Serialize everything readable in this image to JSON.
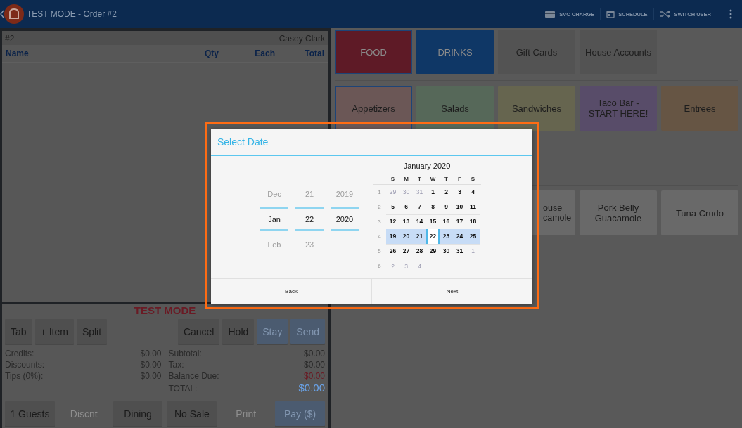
{
  "topbar": {
    "title": "TEST MODE - Order #2",
    "actions": [
      {
        "label": "SVC CHARGE",
        "kind": "card"
      },
      {
        "label": "SCHEDULE",
        "kind": "calendar"
      },
      {
        "label": "SWITCH USER",
        "kind": "shuffle"
      }
    ]
  },
  "order": {
    "number": "#2",
    "customer": "Casey Clark",
    "columns": [
      "Name",
      "Qty",
      "Each",
      "Total"
    ],
    "mode_banner": "TEST MODE",
    "actions": [
      {
        "label": "Tab",
        "kind": "plain",
        "disabled": false
      },
      {
        "label": "+ Item",
        "kind": "plain",
        "disabled": false
      },
      {
        "label": "Split",
        "kind": "plain",
        "disabled": false
      },
      {
        "label": "Cancel",
        "kind": "plain",
        "disabled": false
      },
      {
        "label": "Hold",
        "kind": "plain",
        "disabled": false
      },
      {
        "label": "Stay",
        "kind": "primary",
        "disabled": true
      },
      {
        "label": "Send",
        "kind": "primary",
        "disabled": true
      }
    ],
    "left_totals": [
      {
        "label": "Credits:",
        "value": "$0.00",
        "kind": "plain"
      },
      {
        "label": "Discounts:",
        "value": "$0.00",
        "kind": "plain"
      },
      {
        "label": "Tips (0%):",
        "value": "$0.00",
        "kind": "plain"
      }
    ],
    "right_totals": [
      {
        "label": "Subtotal:",
        "value": "$0.00",
        "kind": "plain"
      },
      {
        "label": "Tax:",
        "value": "$0.00",
        "kind": "plain"
      },
      {
        "label": "Balance Due:",
        "value": "$0.00",
        "kind": "due"
      },
      {
        "label": "TOTAL:",
        "value": "$0.00",
        "kind": "total"
      }
    ],
    "bottom_actions": [
      {
        "label": "1 Guests",
        "kind": "plain",
        "disabled": false
      },
      {
        "label": "Discnt",
        "kind": "plain",
        "disabled": true
      },
      {
        "label": "Dining",
        "kind": "plain",
        "disabled": false
      },
      {
        "label": "No Sale",
        "kind": "plain",
        "disabled": false
      },
      {
        "label": "Print",
        "kind": "plain",
        "disabled": true
      },
      {
        "label": "Pay ($)",
        "kind": "primary",
        "disabled": true
      }
    ]
  },
  "menu": {
    "rows": [
      {
        "tiles": [
          {
            "label": "FOOD",
            "color": "#5e1a26",
            "selected": true
          },
          {
            "label": "DRINKS",
            "color": "#0f3766",
            "selected": false
          },
          {
            "label": "Gift Cards",
            "color": "#535353",
            "selected": false
          },
          {
            "label": "House Accounts",
            "color": "#535353",
            "selected": false
          }
        ]
      },
      {
        "tiles": [
          {
            "label": "Appetizers",
            "color": "#6b5756",
            "selected": true
          },
          {
            "label": "Salads",
            "color": "#566859",
            "selected": false
          },
          {
            "label": "Sandwiches",
            "color": "#66654f",
            "selected": false
          },
          {
            "label": "Taco Bar - START HERE!",
            "color": "#584c69",
            "selected": false
          },
          {
            "label": "Entrees",
            "color": "#665544",
            "selected": false
          }
        ]
      },
      {
        "tiles": [
          {
            "label": "ouse camole",
            "color": "#696969",
            "selected": false,
            "kind": "partial"
          },
          {
            "label": "Pork Belly Guacamole",
            "color": "#696969",
            "selected": false,
            "kind": "full"
          },
          {
            "label": "Tuna Crudo",
            "color": "#696969",
            "selected": false,
            "kind": "full"
          }
        ]
      }
    ]
  },
  "dialog": {
    "title": "Select Date",
    "spinners": [
      {
        "prev": "Dec",
        "current": "Jan",
        "next": "Feb"
      },
      {
        "prev": "21",
        "current": "22",
        "next": "23"
      },
      {
        "prev": "2019",
        "current": "2020"
      }
    ],
    "calendar": {
      "month": "January 2020",
      "weekdays": [
        "S",
        "M",
        "T",
        "W",
        "T",
        "F",
        "S"
      ],
      "weeks": [
        {
          "number": "1",
          "days": [
            {
              "label": "29",
              "muted": true,
              "in_range": false,
              "selected": false
            },
            {
              "label": "30",
              "muted": true,
              "in_range": false,
              "selected": false
            },
            {
              "label": "31",
              "muted": true,
              "in_range": false,
              "selected": false
            },
            {
              "label": "1",
              "muted": false,
              "in_range": false,
              "selected": false
            },
            {
              "label": "2",
              "muted": false,
              "in_range": false,
              "selected": false
            },
            {
              "label": "3",
              "muted": false,
              "in_range": false,
              "selected": false
            },
            {
              "label": "4",
              "muted": false,
              "in_range": false,
              "selected": false
            }
          ]
        },
        {
          "number": "2",
          "days": [
            {
              "label": "5",
              "muted": false,
              "in_range": false,
              "selected": false
            },
            {
              "label": "6",
              "muted": false,
              "in_range": false,
              "selected": false
            },
            {
              "label": "7",
              "muted": false,
              "in_range": false,
              "selected": false
            },
            {
              "label": "8",
              "muted": false,
              "in_range": false,
              "selected": false
            },
            {
              "label": "9",
              "muted": false,
              "in_range": false,
              "selected": false
            },
            {
              "label": "10",
              "muted": false,
              "in_range": false,
              "selected": false
            },
            {
              "label": "11",
              "muted": false,
              "in_range": false,
              "selected": false
            }
          ]
        },
        {
          "number": "3",
          "days": [
            {
              "label": "12",
              "muted": false,
              "in_range": false,
              "selected": false
            },
            {
              "label": "13",
              "muted": false,
              "in_range": false,
              "selected": false
            },
            {
              "label": "14",
              "muted": false,
              "in_range": false,
              "selected": false
            },
            {
              "label": "15",
              "muted": false,
              "in_range": false,
              "selected": false
            },
            {
              "label": "16",
              "muted": false,
              "in_range": false,
              "selected": false
            },
            {
              "label": "17",
              "muted": false,
              "in_range": false,
              "selected": false
            },
            {
              "label": "18",
              "muted": false,
              "in_range": false,
              "selected": false
            }
          ]
        },
        {
          "number": "4",
          "days": [
            {
              "label": "19",
              "muted": false,
              "in_range": true,
              "selected": false
            },
            {
              "label": "20",
              "muted": false,
              "in_range": true,
              "selected": false
            },
            {
              "label": "21",
              "muted": false,
              "in_range": true,
              "selected": false
            },
            {
              "label": "22",
              "muted": false,
              "in_range": false,
              "selected": true
            },
            {
              "label": "23",
              "muted": false,
              "in_range": true,
              "selected": false
            },
            {
              "label": "24",
              "muted": false,
              "in_range": true,
              "selected": false
            },
            {
              "label": "25",
              "muted": false,
              "in_range": true,
              "selected": false
            }
          ]
        },
        {
          "number": "5",
          "days": [
            {
              "label": "26",
              "muted": false,
              "in_range": false,
              "selected": false
            },
            {
              "label": "27",
              "muted": false,
              "in_range": false,
              "selected": false
            },
            {
              "label": "28",
              "muted": false,
              "in_range": false,
              "selected": false
            },
            {
              "label": "29",
              "muted": false,
              "in_range": false,
              "selected": false
            },
            {
              "label": "30",
              "muted": false,
              "in_range": false,
              "selected": false
            },
            {
              "label": "31",
              "muted": false,
              "in_range": false,
              "selected": false
            },
            {
              "label": "1",
              "muted": true,
              "in_range": false,
              "selected": false
            }
          ]
        },
        {
          "number": "6",
          "days": [
            {
              "label": "2",
              "muted": true,
              "in_range": false,
              "selected": false
            },
            {
              "label": "3",
              "muted": true,
              "in_range": false,
              "selected": false
            },
            {
              "label": "4",
              "muted": true,
              "in_range": false,
              "selected": false
            }
          ]
        }
      ]
    },
    "buttons": [
      "Back",
      "Next"
    ]
  }
}
